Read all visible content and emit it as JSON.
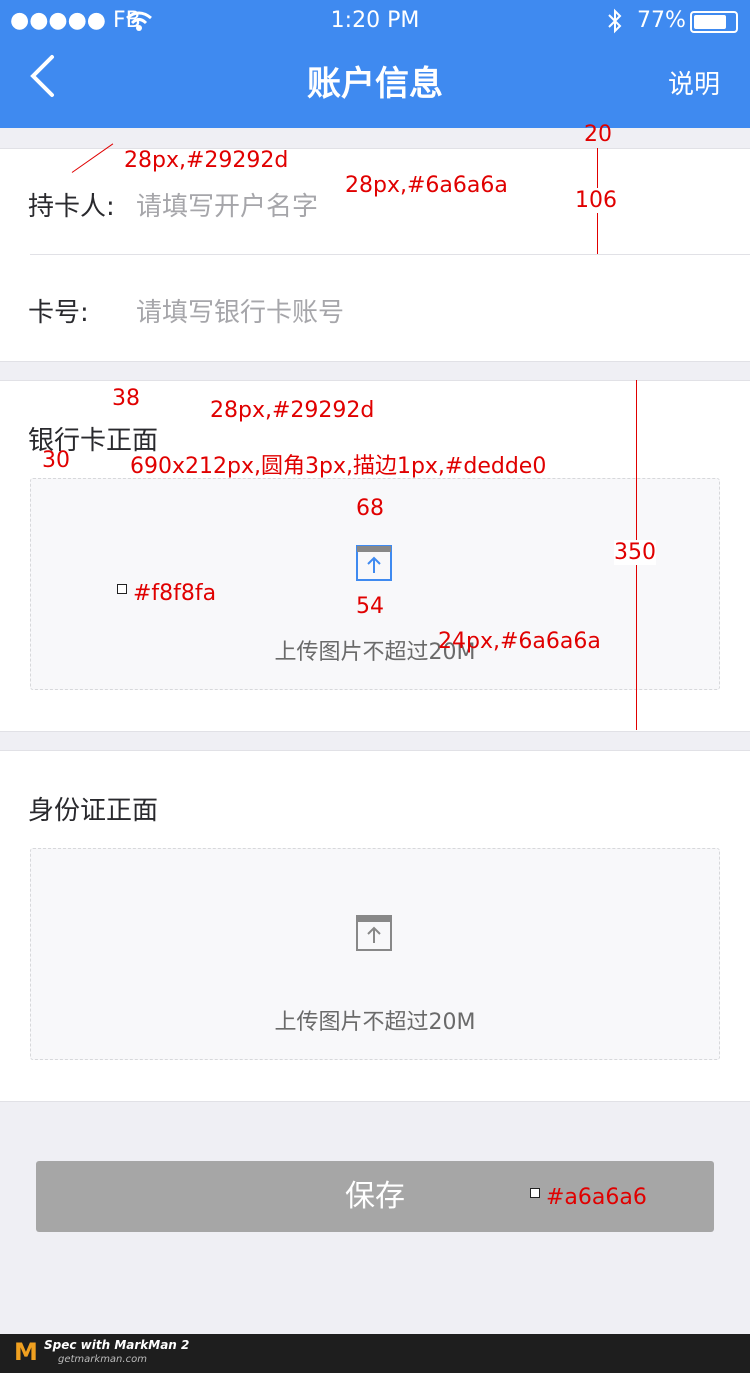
{
  "status_bar": {
    "carrier": "●●●●● FB",
    "time": "1:20 PM",
    "battery": "77%"
  },
  "nav": {
    "title": "账户信息",
    "right": "说明"
  },
  "form": {
    "holder_label": "持卡人:",
    "holder_placeholder": "请填写开户名字",
    "card_label": "卡号:",
    "card_placeholder": "请填写银行卡账号"
  },
  "bank_card": {
    "title": "银行卡正面",
    "upload_text": "上传图片不超过20M"
  },
  "id_card": {
    "title": "身份证正面",
    "upload_text": "上传图片不超过20M"
  },
  "save_label": "保存",
  "annotations": {
    "a20": "20",
    "a106": "106",
    "a_holder_label": "28px,#29292d",
    "a_holder_ph": "28px,#6a6a6a",
    "a38": "38",
    "a_bank_title": "28px,#29292d",
    "a30": "30",
    "a_box": "690x212px,圆角3px,描边1px,#dedde0",
    "a68": "68",
    "a54": "54",
    "a350": "350",
    "a_bg": "#f8f8fa",
    "a_upload_text": "24px,#6a6a6a",
    "a_btn": "#a6a6a6"
  },
  "footer": {
    "brand": "Spec with MarkMan 2",
    "site": "getmarkman.com"
  },
  "colors": {
    "primary": "#3f8af0",
    "button": "#a6a6a6",
    "upload_bg": "#f8f8fa"
  }
}
